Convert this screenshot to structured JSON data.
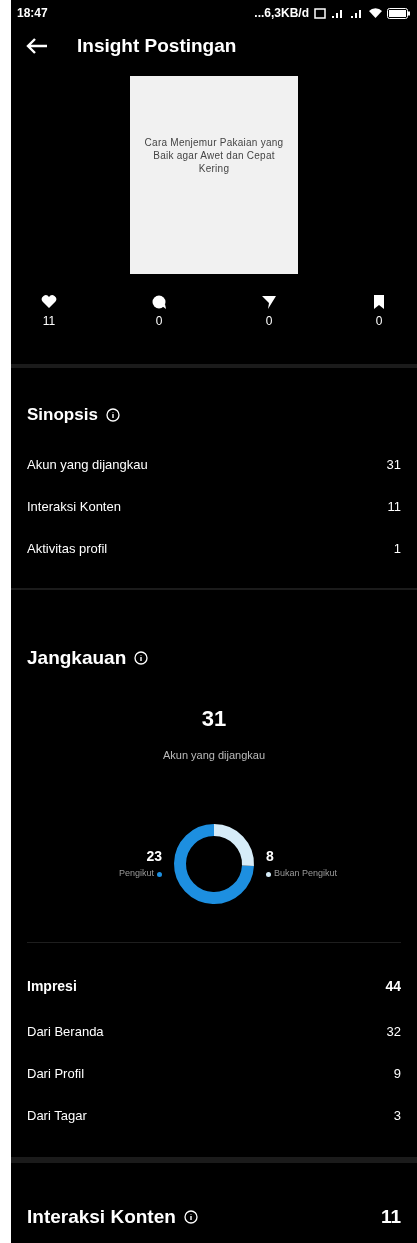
{
  "status_bar": {
    "time": "18:47",
    "network_speed": "...6,3KB/d"
  },
  "header": {
    "title": "Insight Postingan"
  },
  "post": {
    "caption": "Cara Menjemur Pakaian yang Baik agar Awet dan Cepat Kering"
  },
  "post_stats": [
    {
      "kind": "like",
      "value": "11"
    },
    {
      "kind": "comment",
      "value": "0"
    },
    {
      "kind": "share",
      "value": "0"
    },
    {
      "kind": "save",
      "value": "0"
    }
  ],
  "synopsis": {
    "title": "Sinopsis",
    "rows": [
      {
        "label": "Akun yang dijangkau",
        "value": "31"
      },
      {
        "label": "Interaksi Konten",
        "value": "11"
      },
      {
        "label": "Aktivitas profil",
        "value": "1"
      }
    ]
  },
  "reach": {
    "title": "Jangkauan",
    "total": "31",
    "total_label": "Akun yang dijangkau",
    "breakdown": [
      {
        "label": "Pengikut",
        "value": "23",
        "color": "#1d8fe0"
      },
      {
        "label": "Bukan Pengikut",
        "value": "8",
        "color": "#d6ecf8"
      }
    ]
  },
  "impressions": {
    "title": "Impresi",
    "value": "44",
    "rows": [
      {
        "label": "Dari Beranda",
        "value": "32"
      },
      {
        "label": "Dari Profil",
        "value": "9"
      },
      {
        "label": "Dari Tagar",
        "value": "3"
      }
    ]
  },
  "content_interactions": {
    "title": "Interaksi Konten",
    "value": "11"
  }
}
